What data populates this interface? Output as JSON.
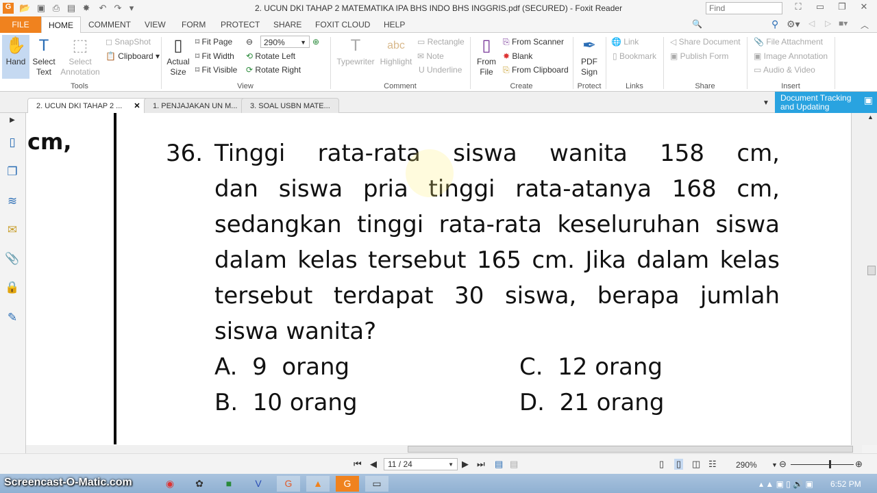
{
  "window": {
    "title": "2. UCUN DKI TAHAP 2 MATEMATIKA IPA BHS INDO BHS INGGRIS.pdf (SECURED) - Foxit Reader"
  },
  "menu": {
    "tabs": [
      "FILE",
      "HOME",
      "COMMENT",
      "VIEW",
      "FORM",
      "PROTECT",
      "SHARE",
      "FOXIT CLOUD",
      "HELP"
    ],
    "find_placeholder": "Find"
  },
  "ribbon": {
    "tools": {
      "hand": "Hand",
      "select_text": [
        "Select",
        "Text"
      ],
      "select_annotation": [
        "Select",
        "Annotation"
      ],
      "snapshot": "SnapShot",
      "clipboard": "Clipboard",
      "label": "Tools"
    },
    "view": {
      "actual_size": [
        "Actual",
        "Size"
      ],
      "fit_page": "Fit Page",
      "fit_width": "Fit Width",
      "fit_visible": "Fit Visible",
      "zoom": "290%",
      "rotate_left": "Rotate Left",
      "rotate_right": "Rotate Right",
      "label": "View"
    },
    "comment": {
      "typewriter": "Typewriter",
      "highlight": "Highlight",
      "rectangle": "Rectangle",
      "note": "Note",
      "underline": "Underline",
      "label": "Comment"
    },
    "create": {
      "from_file": [
        "From",
        "File"
      ],
      "from_scanner": "From Scanner",
      "blank": "Blank",
      "from_clipboard": "From Clipboard",
      "label": "Create"
    },
    "protect": {
      "pdf_sign": [
        "PDF",
        "Sign"
      ],
      "label": "Protect"
    },
    "links": {
      "link": "Link",
      "bookmark": "Bookmark",
      "label": "Links"
    },
    "share": {
      "share_document": "Share Document",
      "publish_form": "Publish Form",
      "label": "Share"
    },
    "insert": {
      "file_attachment": "File Attachment",
      "image_annotation": "Image Annotation",
      "audio_video": "Audio & Video",
      "label": "Insert"
    }
  },
  "doc_tabs": [
    "2. UCUN DKI TAHAP 2 ...",
    "1. PENJAJAKAN UN M...",
    "3. SOAL USBN MATE..."
  ],
  "tracking_banner": [
    "Document Tracking",
    "and Updating"
  ],
  "document": {
    "prev_fragment": "cm,",
    "number": "36.",
    "lines": [
      "Tinggi rata-rata siswa wanita 158 cm,",
      "dan siswa pria tinggi rata-atanya 168 cm,",
      "sedangkan tinggi rata-rata keseluruhan siswa",
      "dalam kelas tersebut 165 cm. Jika dalam kelas",
      "tersebut terdapat 30 siswa, berapa jumlah"
    ],
    "last_line": "siswa wanita?",
    "options": {
      "A": "A.  9  orang",
      "B": "B.  10 orang",
      "C": "C.  12 orang",
      "D": "D.  21 orang"
    }
  },
  "status": {
    "page": "11 / 24",
    "zoom": "290%",
    "zoom_level_percent": 290
  },
  "taskbar": {
    "watermark": "Screencast-O-Matic.com",
    "clock": "6:52 PM"
  }
}
